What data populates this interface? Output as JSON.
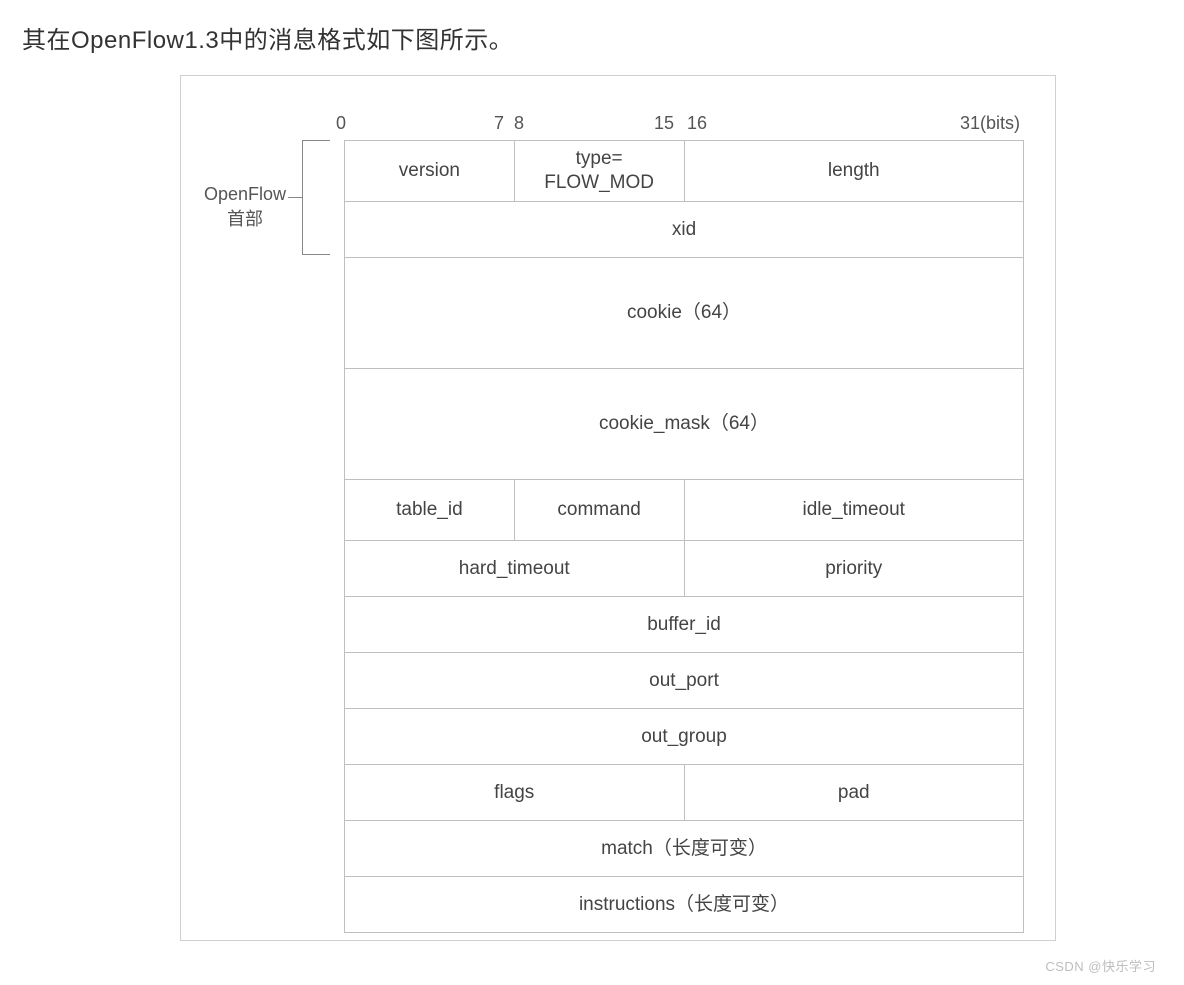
{
  "caption": "其在OpenFlow1.3中的消息格式如下图所示。",
  "header_label_line1": "OpenFlow",
  "header_label_line2": "首部",
  "ruler": {
    "t0": "0",
    "t7": "7",
    "t8": "8",
    "t15": "15",
    "t16": "16",
    "t31": "31(bits)"
  },
  "fields": {
    "version": "version",
    "type": "type=\nFLOW_MOD",
    "length": "length",
    "xid": "xid",
    "cookie": "cookie（64）",
    "cookie_mask": "cookie_mask（64）",
    "table_id": "table_id",
    "command": "command",
    "idle_timeout": "idle_timeout",
    "hard_timeout": "hard_timeout",
    "priority": "priority",
    "buffer_id": "buffer_id",
    "out_port": "out_port",
    "out_group": "out_group",
    "flags": "flags",
    "pad": "pad",
    "match": "match（长度可变）",
    "instructions": "instructions（长度可变）"
  },
  "watermark": "CSDN @快乐学习"
}
